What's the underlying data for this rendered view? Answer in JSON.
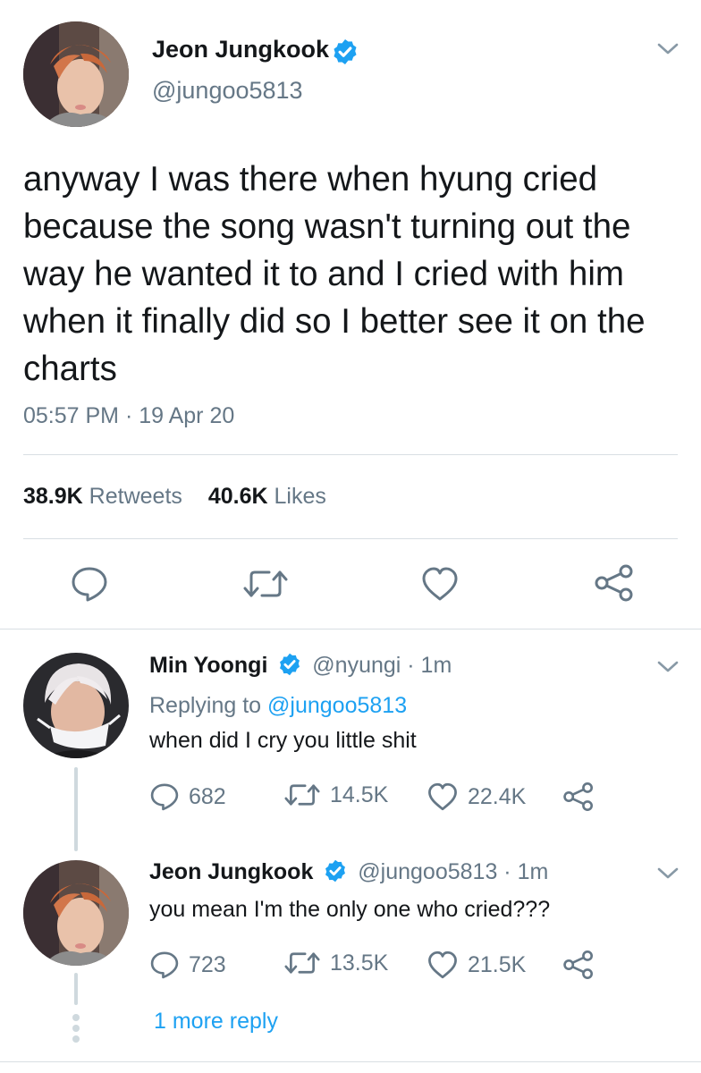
{
  "main_tweet": {
    "author_name": "Jeon Jungkook",
    "handle": "@jungoo5813",
    "text": "anyway I was there when hyung cried because the song wasn't turning out the way he wanted it to and I cried with him when it finally did so I better see it on the charts",
    "timestamp": "05:57 PM · 19 Apr 20",
    "retweets_count": "38.9K",
    "retweets_label": "Retweets",
    "likes_count": "40.6K",
    "likes_label": "Likes"
  },
  "replies": [
    {
      "author_name": "Min Yoongi",
      "handle_time": "@nyungi · 1m",
      "replying_prefix": "Replying to",
      "replying_handle": "@jungoo5813",
      "text": "when did I cry you little shit",
      "reply_count": "682",
      "retweet_count": "14.5K",
      "like_count": "22.4K"
    },
    {
      "author_name": "Jeon Jungkook",
      "handle_time": "@jungoo5813 · 1m",
      "text": "you mean I'm the only one who cried???",
      "reply_count": "723",
      "retweet_count": "13.5K",
      "like_count": "21.5K"
    }
  ],
  "more_replies_link": "1 more reply",
  "colors": {
    "accent": "#1da1f2",
    "text": "#14171a",
    "secondary": "#657786",
    "divider": "#d8dee3"
  }
}
